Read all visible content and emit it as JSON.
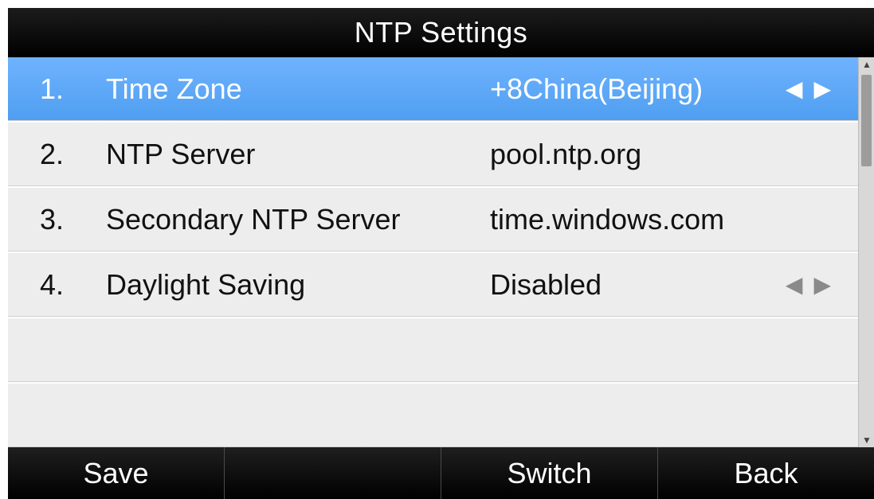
{
  "header": {
    "title": "NTP Settings"
  },
  "settings": {
    "items": [
      {
        "number": "1.",
        "label": "Time Zone",
        "value": "+8China(Beijing)",
        "arrows": "◀▶",
        "selected": true
      },
      {
        "number": "2.",
        "label": "NTP Server",
        "value": "pool.ntp.org",
        "arrows": "",
        "selected": false
      },
      {
        "number": "3.",
        "label": "Secondary NTP Server",
        "value": "time.windows.com",
        "arrows": "",
        "selected": false
      },
      {
        "number": "4.",
        "label": "Daylight Saving",
        "value": "Disabled",
        "arrows": "◀▶",
        "selected": false
      }
    ]
  },
  "scrollbar": {
    "up_glyph": "▲",
    "down_glyph": "▼"
  },
  "softkeys": {
    "labels": [
      "Save",
      "",
      "Switch",
      "Back"
    ]
  },
  "colors": {
    "selection": "#5aa7f5",
    "title_bar": "#000000",
    "list_bg": "#ededed"
  }
}
